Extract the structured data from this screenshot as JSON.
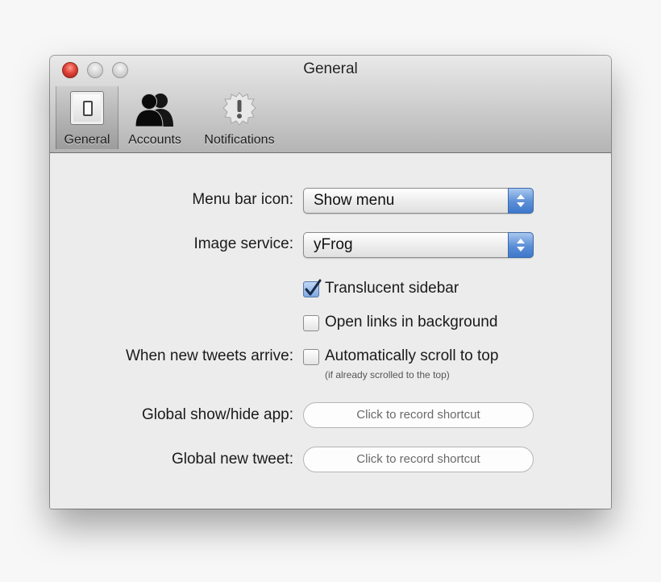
{
  "window": {
    "title": "General"
  },
  "toolbar": {
    "items": [
      {
        "label": "General",
        "icon": "switch-icon",
        "selected": true
      },
      {
        "label": "Accounts",
        "icon": "people-icon",
        "selected": false
      },
      {
        "label": "Notifications",
        "icon": "alert-icon",
        "selected": false
      }
    ]
  },
  "settings": {
    "menu_bar_icon": {
      "label": "Menu bar icon:",
      "value": "Show menu"
    },
    "image_service": {
      "label": "Image service:",
      "value": "yFrog"
    },
    "translucent_sidebar": {
      "label": "Translucent sidebar",
      "checked": true
    },
    "open_links": {
      "label": "Open links in background",
      "checked": false
    },
    "new_tweets": {
      "label": "When new tweets arrive:",
      "option": "Automatically scroll to top",
      "checked": false,
      "hint": "(if already scrolled to the top)"
    },
    "global_show_hide": {
      "label": "Global show/hide app:",
      "placeholder": "Click to record shortcut"
    },
    "global_new_tweet": {
      "label": "Global new tweet:",
      "placeholder": "Click to record shortcut"
    }
  },
  "colors": {
    "accent": "#5b8ed6",
    "close_button": "#e0443a"
  }
}
